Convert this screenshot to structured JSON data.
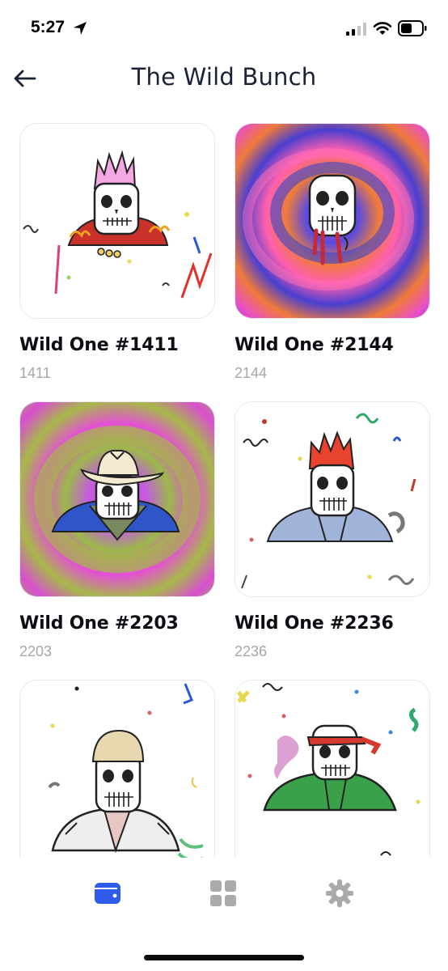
{
  "status_bar": {
    "time": "5:27",
    "location_icon": "location-arrow-icon",
    "signal_icon": "cellular-signal-icon",
    "wifi_icon": "wifi-icon",
    "battery_icon": "battery-icon"
  },
  "header": {
    "back_icon": "arrow-left-icon",
    "title": "The Wild Bunch"
  },
  "nfts": [
    {
      "name": "Wild One #1411",
      "id": "1411"
    },
    {
      "name": "Wild One #2144",
      "id": "2144"
    },
    {
      "name": "Wild One #2203",
      "id": "2203"
    },
    {
      "name": "Wild One #2236",
      "id": "2236"
    },
    {
      "name": "",
      "id": ""
    },
    {
      "name": "",
      "id": ""
    }
  ],
  "tab_bar": {
    "tabs": [
      {
        "icon": "wallet-icon",
        "active": true
      },
      {
        "icon": "grid-icon",
        "active": false
      },
      {
        "icon": "gear-icon",
        "active": false
      }
    ]
  },
  "colors": {
    "accent": "#2f5bea",
    "title_text": "#1a2238",
    "secondary_text": "#a6a6ab",
    "inactive_icon": "#aaaaaa"
  }
}
